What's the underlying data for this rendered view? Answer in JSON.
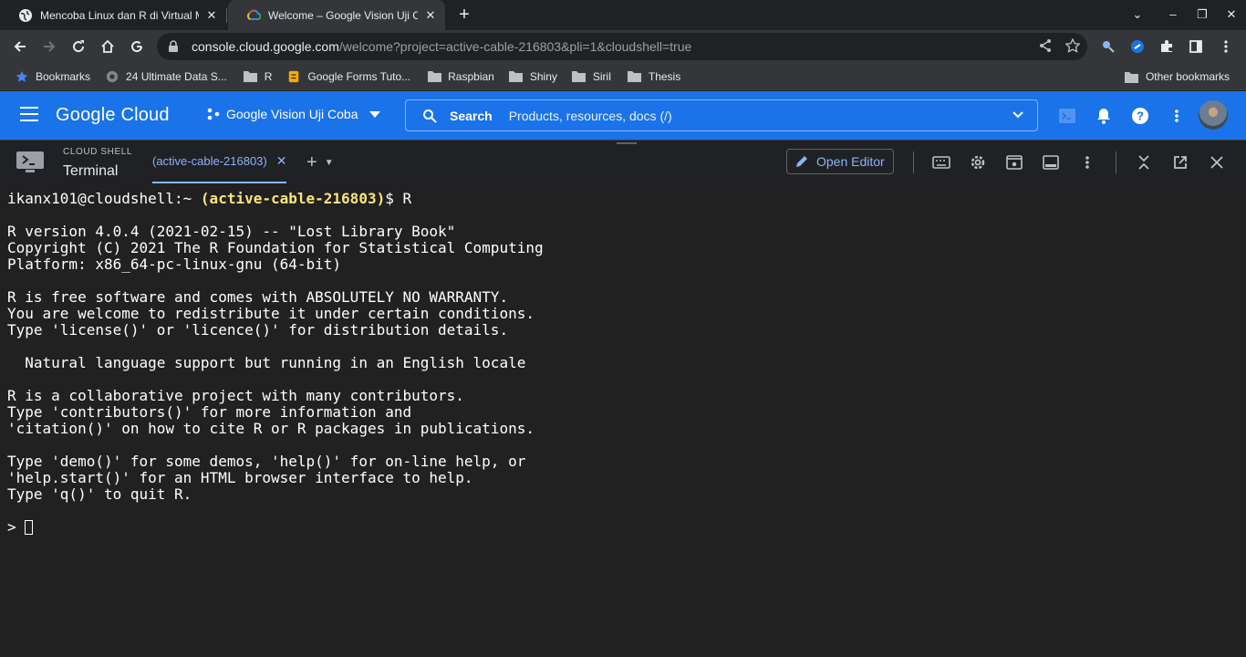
{
  "browser": {
    "tabs": [
      {
        "title": "Mencoba Linux dan R di Virtual M",
        "active": false,
        "favicon": "globe-icon"
      },
      {
        "title": "Welcome – Google Vision Uji C",
        "active": true,
        "favicon": "google-cloud-icon"
      }
    ],
    "url_host": "console.cloud.google.com",
    "url_path": "/welcome?project=active-cable-216803&pli=1&cloudshell=true"
  },
  "bookmarks": {
    "items": [
      {
        "label": "Bookmarks",
        "icon": "star-icon"
      },
      {
        "label": "24 Ultimate Data S...",
        "icon": "site-icon"
      },
      {
        "label": "R",
        "icon": "folder-icon"
      },
      {
        "label": "Google Forms Tuto...",
        "icon": "site-icon"
      },
      {
        "label": "Raspbian",
        "icon": "folder-icon"
      },
      {
        "label": "Shiny",
        "icon": "folder-icon"
      },
      {
        "label": "Siril",
        "icon": "folder-icon"
      },
      {
        "label": "Thesis",
        "icon": "folder-icon"
      }
    ],
    "other": "Other bookmarks"
  },
  "gcloud": {
    "logo": "Google Cloud",
    "project": "Google Vision Uji Coba",
    "search_label": "Search",
    "search_placeholder": "Products, resources, docs (/)",
    "colors": {
      "header": "#1a73e8",
      "accent": "#8ab4f8",
      "prompt_project": "#fde47f"
    }
  },
  "cloudshell": {
    "small_label": "CLOUD SHELL",
    "title": "Terminal",
    "tab_label": "(active-cable-216803)",
    "open_editor": "Open Editor"
  },
  "terminal": {
    "prompt_user": "ikanx101@cloudshell:~ ",
    "prompt_project": "(active-cable-216803)",
    "prompt_cmd": "$ R",
    "lines": [
      "",
      "R version 4.0.4 (2021-02-15) -- \"Lost Library Book\"",
      "Copyright (C) 2021 The R Foundation for Statistical Computing",
      "Platform: x86_64-pc-linux-gnu (64-bit)",
      "",
      "R is free software and comes with ABSOLUTELY NO WARRANTY.",
      "You are welcome to redistribute it under certain conditions.",
      "Type 'license()' or 'licence()' for distribution details.",
      "",
      "  Natural language support but running in an English locale",
      "",
      "R is a collaborative project with many contributors.",
      "Type 'contributors()' for more information and",
      "'citation()' on how to cite R or R packages in publications.",
      "",
      "Type 'demo()' for some demos, 'help()' for on-line help, or",
      "'help.start()' for an HTML browser interface to help.",
      "Type 'q()' to quit R.",
      ""
    ],
    "final_prompt": "> "
  }
}
